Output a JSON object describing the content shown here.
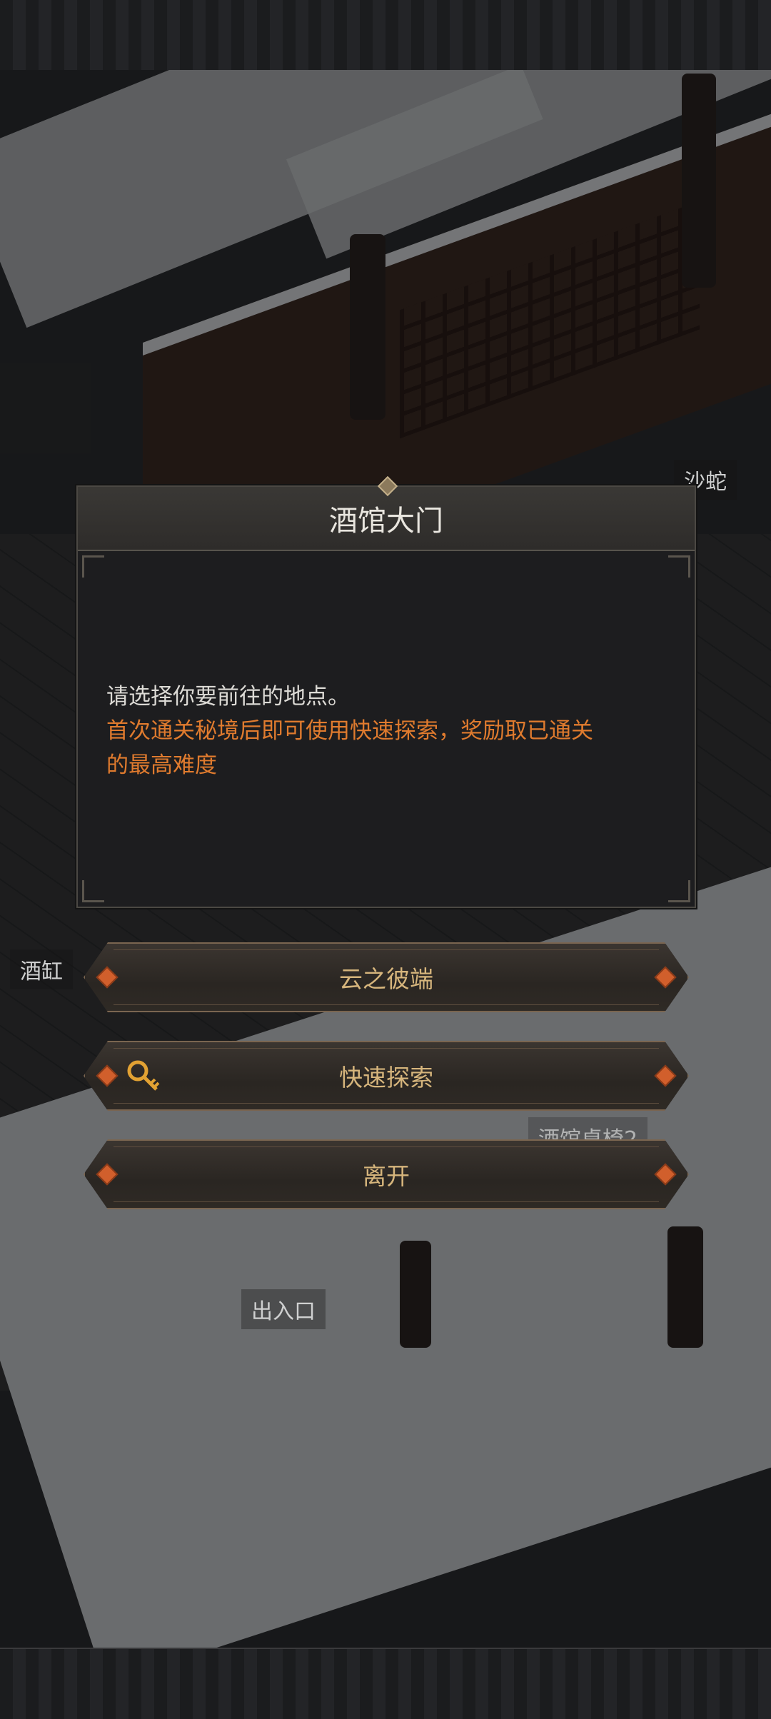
{
  "map_labels": {
    "sha_she": "沙蛇",
    "jiu_gang": "酒缸",
    "chu_ru_kou": "出入口",
    "jiu_guan_zhuo_yi": "酒馆桌椅2"
  },
  "dialog": {
    "title": "酒馆大门",
    "prompt": "请选择你要前往的地点。",
    "notice_line1": "首次通关秘境后即可使用快速探索，奖励取已通关",
    "notice_line2": "的最高难度"
  },
  "buttons": {
    "yun_zhi_bi_duan": "云之彼端",
    "quick_explore": "快速探索",
    "leave": "离开"
  },
  "colors": {
    "notice": "#e07b2e",
    "button_text": "#d6b57c",
    "gem": "#d15f2c"
  },
  "icons": {
    "quick_explore": "key-icon"
  }
}
